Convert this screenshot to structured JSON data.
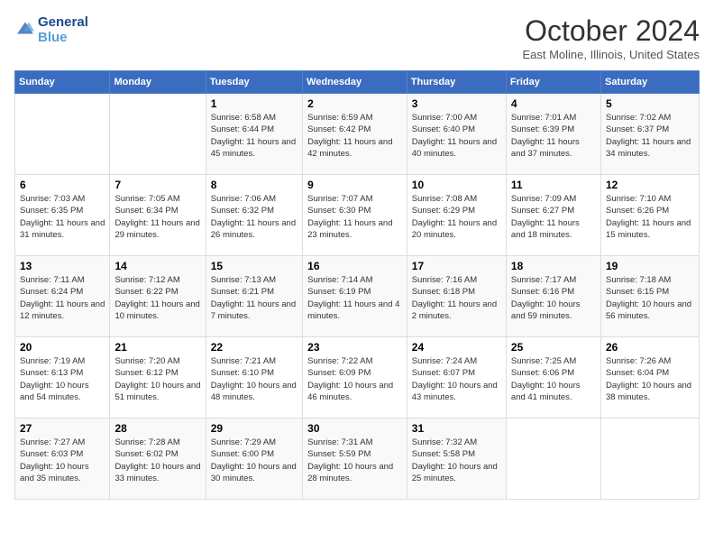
{
  "header": {
    "logo_line1": "General",
    "logo_line2": "Blue",
    "month": "October 2024",
    "location": "East Moline, Illinois, United States"
  },
  "weekdays": [
    "Sunday",
    "Monday",
    "Tuesday",
    "Wednesday",
    "Thursday",
    "Friday",
    "Saturday"
  ],
  "weeks": [
    [
      {
        "day": "",
        "sunrise": "",
        "sunset": "",
        "daylight": ""
      },
      {
        "day": "",
        "sunrise": "",
        "sunset": "",
        "daylight": ""
      },
      {
        "day": "1",
        "sunrise": "Sunrise: 6:58 AM",
        "sunset": "Sunset: 6:44 PM",
        "daylight": "Daylight: 11 hours and 45 minutes."
      },
      {
        "day": "2",
        "sunrise": "Sunrise: 6:59 AM",
        "sunset": "Sunset: 6:42 PM",
        "daylight": "Daylight: 11 hours and 42 minutes."
      },
      {
        "day": "3",
        "sunrise": "Sunrise: 7:00 AM",
        "sunset": "Sunset: 6:40 PM",
        "daylight": "Daylight: 11 hours and 40 minutes."
      },
      {
        "day": "4",
        "sunrise": "Sunrise: 7:01 AM",
        "sunset": "Sunset: 6:39 PM",
        "daylight": "Daylight: 11 hours and 37 minutes."
      },
      {
        "day": "5",
        "sunrise": "Sunrise: 7:02 AM",
        "sunset": "Sunset: 6:37 PM",
        "daylight": "Daylight: 11 hours and 34 minutes."
      }
    ],
    [
      {
        "day": "6",
        "sunrise": "Sunrise: 7:03 AM",
        "sunset": "Sunset: 6:35 PM",
        "daylight": "Daylight: 11 hours and 31 minutes."
      },
      {
        "day": "7",
        "sunrise": "Sunrise: 7:05 AM",
        "sunset": "Sunset: 6:34 PM",
        "daylight": "Daylight: 11 hours and 29 minutes."
      },
      {
        "day": "8",
        "sunrise": "Sunrise: 7:06 AM",
        "sunset": "Sunset: 6:32 PM",
        "daylight": "Daylight: 11 hours and 26 minutes."
      },
      {
        "day": "9",
        "sunrise": "Sunrise: 7:07 AM",
        "sunset": "Sunset: 6:30 PM",
        "daylight": "Daylight: 11 hours and 23 minutes."
      },
      {
        "day": "10",
        "sunrise": "Sunrise: 7:08 AM",
        "sunset": "Sunset: 6:29 PM",
        "daylight": "Daylight: 11 hours and 20 minutes."
      },
      {
        "day": "11",
        "sunrise": "Sunrise: 7:09 AM",
        "sunset": "Sunset: 6:27 PM",
        "daylight": "Daylight: 11 hours and 18 minutes."
      },
      {
        "day": "12",
        "sunrise": "Sunrise: 7:10 AM",
        "sunset": "Sunset: 6:26 PM",
        "daylight": "Daylight: 11 hours and 15 minutes."
      }
    ],
    [
      {
        "day": "13",
        "sunrise": "Sunrise: 7:11 AM",
        "sunset": "Sunset: 6:24 PM",
        "daylight": "Daylight: 11 hours and 12 minutes."
      },
      {
        "day": "14",
        "sunrise": "Sunrise: 7:12 AM",
        "sunset": "Sunset: 6:22 PM",
        "daylight": "Daylight: 11 hours and 10 minutes."
      },
      {
        "day": "15",
        "sunrise": "Sunrise: 7:13 AM",
        "sunset": "Sunset: 6:21 PM",
        "daylight": "Daylight: 11 hours and 7 minutes."
      },
      {
        "day": "16",
        "sunrise": "Sunrise: 7:14 AM",
        "sunset": "Sunset: 6:19 PM",
        "daylight": "Daylight: 11 hours and 4 minutes."
      },
      {
        "day": "17",
        "sunrise": "Sunrise: 7:16 AM",
        "sunset": "Sunset: 6:18 PM",
        "daylight": "Daylight: 11 hours and 2 minutes."
      },
      {
        "day": "18",
        "sunrise": "Sunrise: 7:17 AM",
        "sunset": "Sunset: 6:16 PM",
        "daylight": "Daylight: 10 hours and 59 minutes."
      },
      {
        "day": "19",
        "sunrise": "Sunrise: 7:18 AM",
        "sunset": "Sunset: 6:15 PM",
        "daylight": "Daylight: 10 hours and 56 minutes."
      }
    ],
    [
      {
        "day": "20",
        "sunrise": "Sunrise: 7:19 AM",
        "sunset": "Sunset: 6:13 PM",
        "daylight": "Daylight: 10 hours and 54 minutes."
      },
      {
        "day": "21",
        "sunrise": "Sunrise: 7:20 AM",
        "sunset": "Sunset: 6:12 PM",
        "daylight": "Daylight: 10 hours and 51 minutes."
      },
      {
        "day": "22",
        "sunrise": "Sunrise: 7:21 AM",
        "sunset": "Sunset: 6:10 PM",
        "daylight": "Daylight: 10 hours and 48 minutes."
      },
      {
        "day": "23",
        "sunrise": "Sunrise: 7:22 AM",
        "sunset": "Sunset: 6:09 PM",
        "daylight": "Daylight: 10 hours and 46 minutes."
      },
      {
        "day": "24",
        "sunrise": "Sunrise: 7:24 AM",
        "sunset": "Sunset: 6:07 PM",
        "daylight": "Daylight: 10 hours and 43 minutes."
      },
      {
        "day": "25",
        "sunrise": "Sunrise: 7:25 AM",
        "sunset": "Sunset: 6:06 PM",
        "daylight": "Daylight: 10 hours and 41 minutes."
      },
      {
        "day": "26",
        "sunrise": "Sunrise: 7:26 AM",
        "sunset": "Sunset: 6:04 PM",
        "daylight": "Daylight: 10 hours and 38 minutes."
      }
    ],
    [
      {
        "day": "27",
        "sunrise": "Sunrise: 7:27 AM",
        "sunset": "Sunset: 6:03 PM",
        "daylight": "Daylight: 10 hours and 35 minutes."
      },
      {
        "day": "28",
        "sunrise": "Sunrise: 7:28 AM",
        "sunset": "Sunset: 6:02 PM",
        "daylight": "Daylight: 10 hours and 33 minutes."
      },
      {
        "day": "29",
        "sunrise": "Sunrise: 7:29 AM",
        "sunset": "Sunset: 6:00 PM",
        "daylight": "Daylight: 10 hours and 30 minutes."
      },
      {
        "day": "30",
        "sunrise": "Sunrise: 7:31 AM",
        "sunset": "Sunset: 5:59 PM",
        "daylight": "Daylight: 10 hours and 28 minutes."
      },
      {
        "day": "31",
        "sunrise": "Sunrise: 7:32 AM",
        "sunset": "Sunset: 5:58 PM",
        "daylight": "Daylight: 10 hours and 25 minutes."
      },
      {
        "day": "",
        "sunrise": "",
        "sunset": "",
        "daylight": ""
      },
      {
        "day": "",
        "sunrise": "",
        "sunset": "",
        "daylight": ""
      }
    ]
  ]
}
